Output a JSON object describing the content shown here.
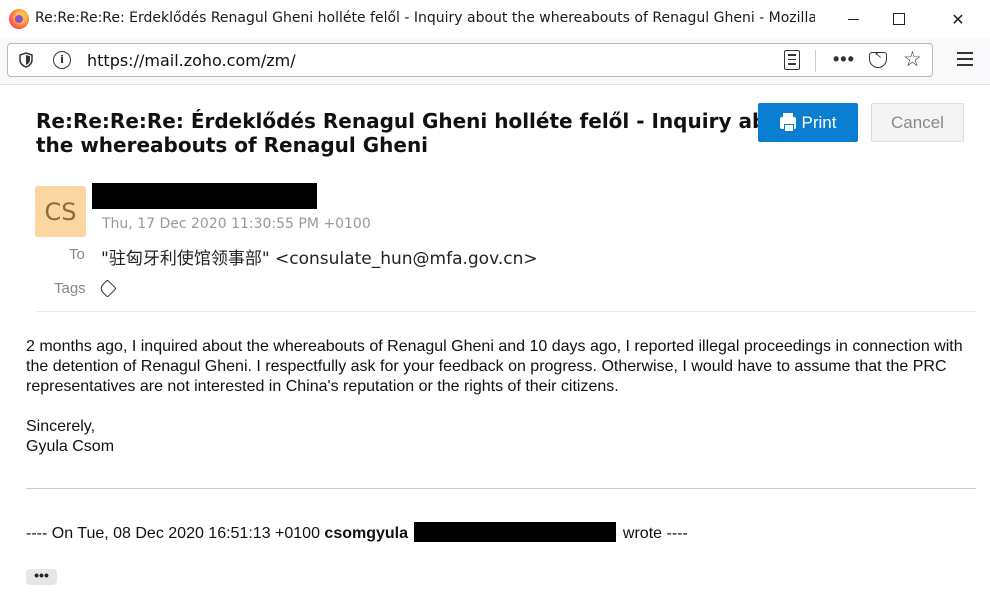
{
  "window": {
    "title": "Re:Re:Re:Re: Érdeklődés Renagul Gheni holléte felől - Inquiry about the whereabouts of Renagul Gheni - Mozilla Fire..."
  },
  "toolbar": {
    "url": "https://mail.zoho.com/zm/",
    "more": "•••"
  },
  "email": {
    "subject": "Re:Re:Re:Re: Érdeklődés Renagul Gheni holléte felől - Inquiry about the whereabouts of Renagul Gheni",
    "print_label": "Print",
    "cancel_label": "Cancel",
    "avatar_initials": "CS",
    "date": "Thu, 17 Dec 2020 11:30:55 PM +0100",
    "to_label": "To",
    "to_value": "\"驻匈牙利使馆领事部\" <consulate_hun@mfa.gov.cn>",
    "tags_label": "Tags",
    "body": [
      "2 months ago, I inquired about the whereabouts of Renagul Gheni and 10 days ago, I reported illegal proceedings in connection with the detention of Renagul Gheni. I respectfully ask for your feedback on progress. Otherwise, I would have to assume that the PRC representatives are not interested in China's reputation or the rights of their citizens.",
      "Sincerely,",
      "Gyula Csom"
    ],
    "quote_prefix": "---- On Tue, 08 Dec 2020 16:51:13 +0100",
    "quote_sender": "csomgyula",
    "quote_suffix": "wrote ----",
    "expand_label": "•••"
  },
  "colors": {
    "print_button": "#0a7fd2",
    "avatar_bg": "#fbd6a0"
  }
}
